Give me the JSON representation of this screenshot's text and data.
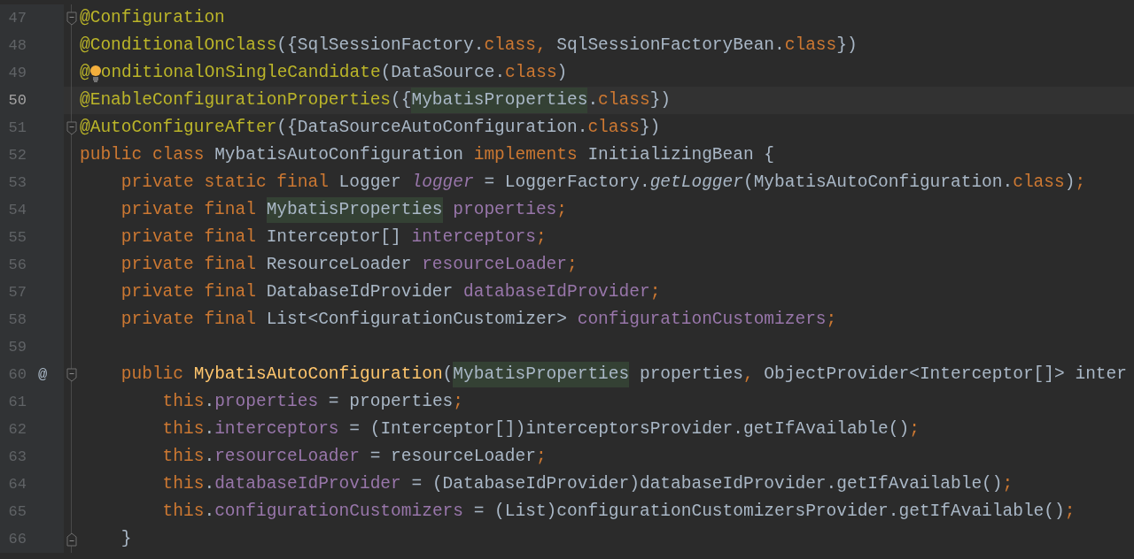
{
  "editor": {
    "lines": [
      {
        "number": "47",
        "selected": false,
        "fold_start": true,
        "tokens": [
          {
            "text": "@Configuration",
            "kind": "annotation"
          }
        ]
      },
      {
        "number": "48",
        "selected": false,
        "tokens": [
          {
            "text": "@ConditionalOnClass",
            "kind": "annotation"
          },
          {
            "text": "({SqlSessionFactory.",
            "kind": "text"
          },
          {
            "text": "class",
            "kind": "keyword"
          },
          {
            "text": ",",
            "kind": "keyword"
          },
          {
            "text": " SqlSessionFactoryBean.",
            "kind": "text"
          },
          {
            "text": "class",
            "kind": "keyword"
          },
          {
            "text": "})",
            "kind": "text"
          }
        ]
      },
      {
        "number": "49",
        "selected": false,
        "tokens": [
          {
            "text": "@",
            "kind": "annotation"
          },
          {
            "kind": "bulb"
          },
          {
            "text": "onditionalOnSingleCandidate",
            "kind": "annotation"
          },
          {
            "text": "(DataSource.",
            "kind": "text"
          },
          {
            "text": "class",
            "kind": "keyword"
          },
          {
            "text": ")",
            "kind": "text"
          }
        ]
      },
      {
        "number": "50",
        "selected": true,
        "tokens": [
          {
            "text": "@EnableConfigurationProperties",
            "kind": "annotation"
          },
          {
            "text": "({",
            "kind": "text"
          },
          {
            "text": "MybatisProperties",
            "kind": "text",
            "highlighted": true
          },
          {
            "text": ".class",
            "kind": "dot_keyword"
          },
          {
            "text": "})",
            "kind": "text"
          }
        ]
      },
      {
        "number": "51",
        "selected": false,
        "fold_start": true,
        "tokens": [
          {
            "text": "@AutoConfigureAfter",
            "kind": "annotation"
          },
          {
            "text": "({DataSourceAutoConfiguration.",
            "kind": "text"
          },
          {
            "text": "class",
            "kind": "keyword"
          },
          {
            "text": "})",
            "kind": "text"
          }
        ]
      },
      {
        "number": "52",
        "selected": false,
        "tokens": [
          {
            "text": "public class",
            "kind": "keyword"
          },
          {
            "text": " MybatisAutoConfiguration ",
            "kind": "text"
          },
          {
            "text": "implements",
            "kind": "keyword"
          },
          {
            "text": " InitializingBean {",
            "kind": "text"
          }
        ]
      },
      {
        "number": "53",
        "selected": false,
        "tokens": [
          {
            "text": "    private static final",
            "kind": "keyword"
          },
          {
            "text": " Logger ",
            "kind": "text"
          },
          {
            "text": "logger",
            "kind": "field_italic"
          },
          {
            "text": " = LoggerFactory.",
            "kind": "text"
          },
          {
            "text": "getLogger",
            "kind": "method_italic"
          },
          {
            "text": "(MybatisAutoConfiguration.",
            "kind": "text"
          },
          {
            "text": "class",
            "kind": "keyword"
          },
          {
            "text": ")",
            "kind": "text"
          },
          {
            "text": ";",
            "kind": "keyword"
          }
        ]
      },
      {
        "number": "54",
        "selected": false,
        "tokens": [
          {
            "text": "    private final ",
            "kind": "keyword"
          },
          {
            "text": "MybatisProperties",
            "kind": "text",
            "highlighted": true
          },
          {
            "text": " properties",
            "kind": "field"
          },
          {
            "text": ";",
            "kind": "keyword"
          }
        ]
      },
      {
        "number": "55",
        "selected": false,
        "tokens": [
          {
            "text": "    private final",
            "kind": "keyword"
          },
          {
            "text": " Interceptor[] ",
            "kind": "text"
          },
          {
            "text": "interceptors",
            "kind": "field"
          },
          {
            "text": ";",
            "kind": "keyword"
          }
        ]
      },
      {
        "number": "56",
        "selected": false,
        "tokens": [
          {
            "text": "    private final",
            "kind": "keyword"
          },
          {
            "text": " ResourceLoader ",
            "kind": "text"
          },
          {
            "text": "resourceLoader",
            "kind": "field"
          },
          {
            "text": ";",
            "kind": "keyword"
          }
        ]
      },
      {
        "number": "57",
        "selected": false,
        "tokens": [
          {
            "text": "    private final",
            "kind": "keyword"
          },
          {
            "text": " DatabaseIdProvider ",
            "kind": "text"
          },
          {
            "text": "databaseIdProvider",
            "kind": "field"
          },
          {
            "text": ";",
            "kind": "keyword"
          }
        ]
      },
      {
        "number": "58",
        "selected": false,
        "tokens": [
          {
            "text": "    private final",
            "kind": "keyword"
          },
          {
            "text": " List<ConfigurationCustomizer> ",
            "kind": "text"
          },
          {
            "text": "configurationCustomizers",
            "kind": "field"
          },
          {
            "text": ";",
            "kind": "keyword"
          }
        ]
      },
      {
        "number": "59",
        "selected": false
      },
      {
        "number": "60",
        "selected": false,
        "gutter_mark": "@",
        "fold_start": true,
        "tokens": [
          {
            "text": "    public ",
            "kind": "keyword"
          },
          {
            "text": "MybatisAutoConfiguration",
            "kind": "method_decl"
          },
          {
            "text": "(",
            "kind": "text"
          },
          {
            "text": "MybatisProperties",
            "kind": "text",
            "highlighted": true
          },
          {
            "text": " properties",
            "kind": "text"
          },
          {
            "text": ",",
            "kind": "keyword"
          },
          {
            "text": " ObjectProvider<Interceptor[]> inter",
            "kind": "text"
          }
        ]
      },
      {
        "number": "61",
        "selected": false,
        "tokens": [
          {
            "text": "        this",
            "kind": "keyword"
          },
          {
            "text": ".",
            "kind": "text"
          },
          {
            "text": "properties",
            "kind": "field"
          },
          {
            "text": " = properties",
            "kind": "text"
          },
          {
            "text": ";",
            "kind": "keyword"
          }
        ]
      },
      {
        "number": "62",
        "selected": false,
        "tokens": [
          {
            "text": "        this",
            "kind": "keyword"
          },
          {
            "text": ".",
            "kind": "text"
          },
          {
            "text": "interceptors",
            "kind": "field"
          },
          {
            "text": " = (Interceptor[])interceptorsProvider.getIfAvailable()",
            "kind": "text"
          },
          {
            "text": ";",
            "kind": "keyword"
          }
        ]
      },
      {
        "number": "63",
        "selected": false,
        "tokens": [
          {
            "text": "        this",
            "kind": "keyword"
          },
          {
            "text": ".",
            "kind": "text"
          },
          {
            "text": "resourceLoader",
            "kind": "field"
          },
          {
            "text": " = resourceLoader",
            "kind": "text"
          },
          {
            "text": ";",
            "kind": "keyword"
          }
        ]
      },
      {
        "number": "64",
        "selected": false,
        "tokens": [
          {
            "text": "        this",
            "kind": "keyword"
          },
          {
            "text": ".",
            "kind": "text"
          },
          {
            "text": "databaseIdProvider",
            "kind": "field"
          },
          {
            "text": " = (DatabaseIdProvider)databaseIdProvider.getIfAvailable()",
            "kind": "text"
          },
          {
            "text": ";",
            "kind": "keyword"
          }
        ]
      },
      {
        "number": "65",
        "selected": false,
        "tokens": [
          {
            "text": "        this",
            "kind": "keyword"
          },
          {
            "text": ".",
            "kind": "text"
          },
          {
            "text": "configurationCustomizers",
            "kind": "field"
          },
          {
            "text": " = (List)configurationCustomizersProvider.getIfAvailable()",
            "kind": "text"
          },
          {
            "text": ";",
            "kind": "keyword"
          }
        ]
      },
      {
        "number": "66",
        "selected": false,
        "fold_end": true,
        "tokens": [
          {
            "text": "    }",
            "kind": "text"
          }
        ]
      }
    ]
  }
}
